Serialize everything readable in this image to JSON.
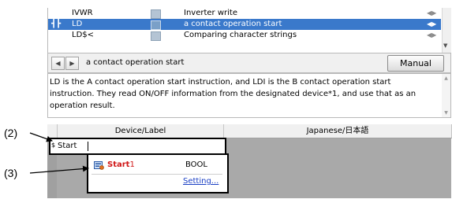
{
  "instruction_list": {
    "rows": [
      {
        "symbol": "",
        "code": "IVWR",
        "description": "Inverter write",
        "selected": false
      },
      {
        "symbol": "┫┣",
        "code": "LD",
        "description": "a contact operation start",
        "selected": true
      },
      {
        "symbol": "",
        "code": "LD$<",
        "description": "Comparing character strings",
        "selected": false
      }
    ]
  },
  "navigation": {
    "back_icon": "triangle-left-icon",
    "forward_icon": "triangle-right-icon",
    "current_text": "a contact operation start",
    "manual_label": "Manual"
  },
  "description": {
    "text": "LD is the A contact operation start instruction, and LDI is the B contact operation start instruction. They read ON/OFF information from the designated device*1, and use that as an operation result."
  },
  "grid": {
    "columns": [
      {
        "label": "Device/Label"
      },
      {
        "label": "Japanese/日本語"
      }
    ],
    "input": {
      "prefix": "$",
      "value": "Start"
    }
  },
  "suggestion": {
    "icon": "label-icon",
    "name_prefix": "Start",
    "name_suffix": "1",
    "type": "BOOL",
    "setting_link": "Setting..."
  },
  "callouts": {
    "c2": "(2)",
    "c3": "(3)"
  },
  "colors": {
    "selection": "#3a79cb",
    "label_red": "#d01818",
    "link_blue": "#1a3fc4",
    "grid_gray": "#a9a9a9"
  }
}
